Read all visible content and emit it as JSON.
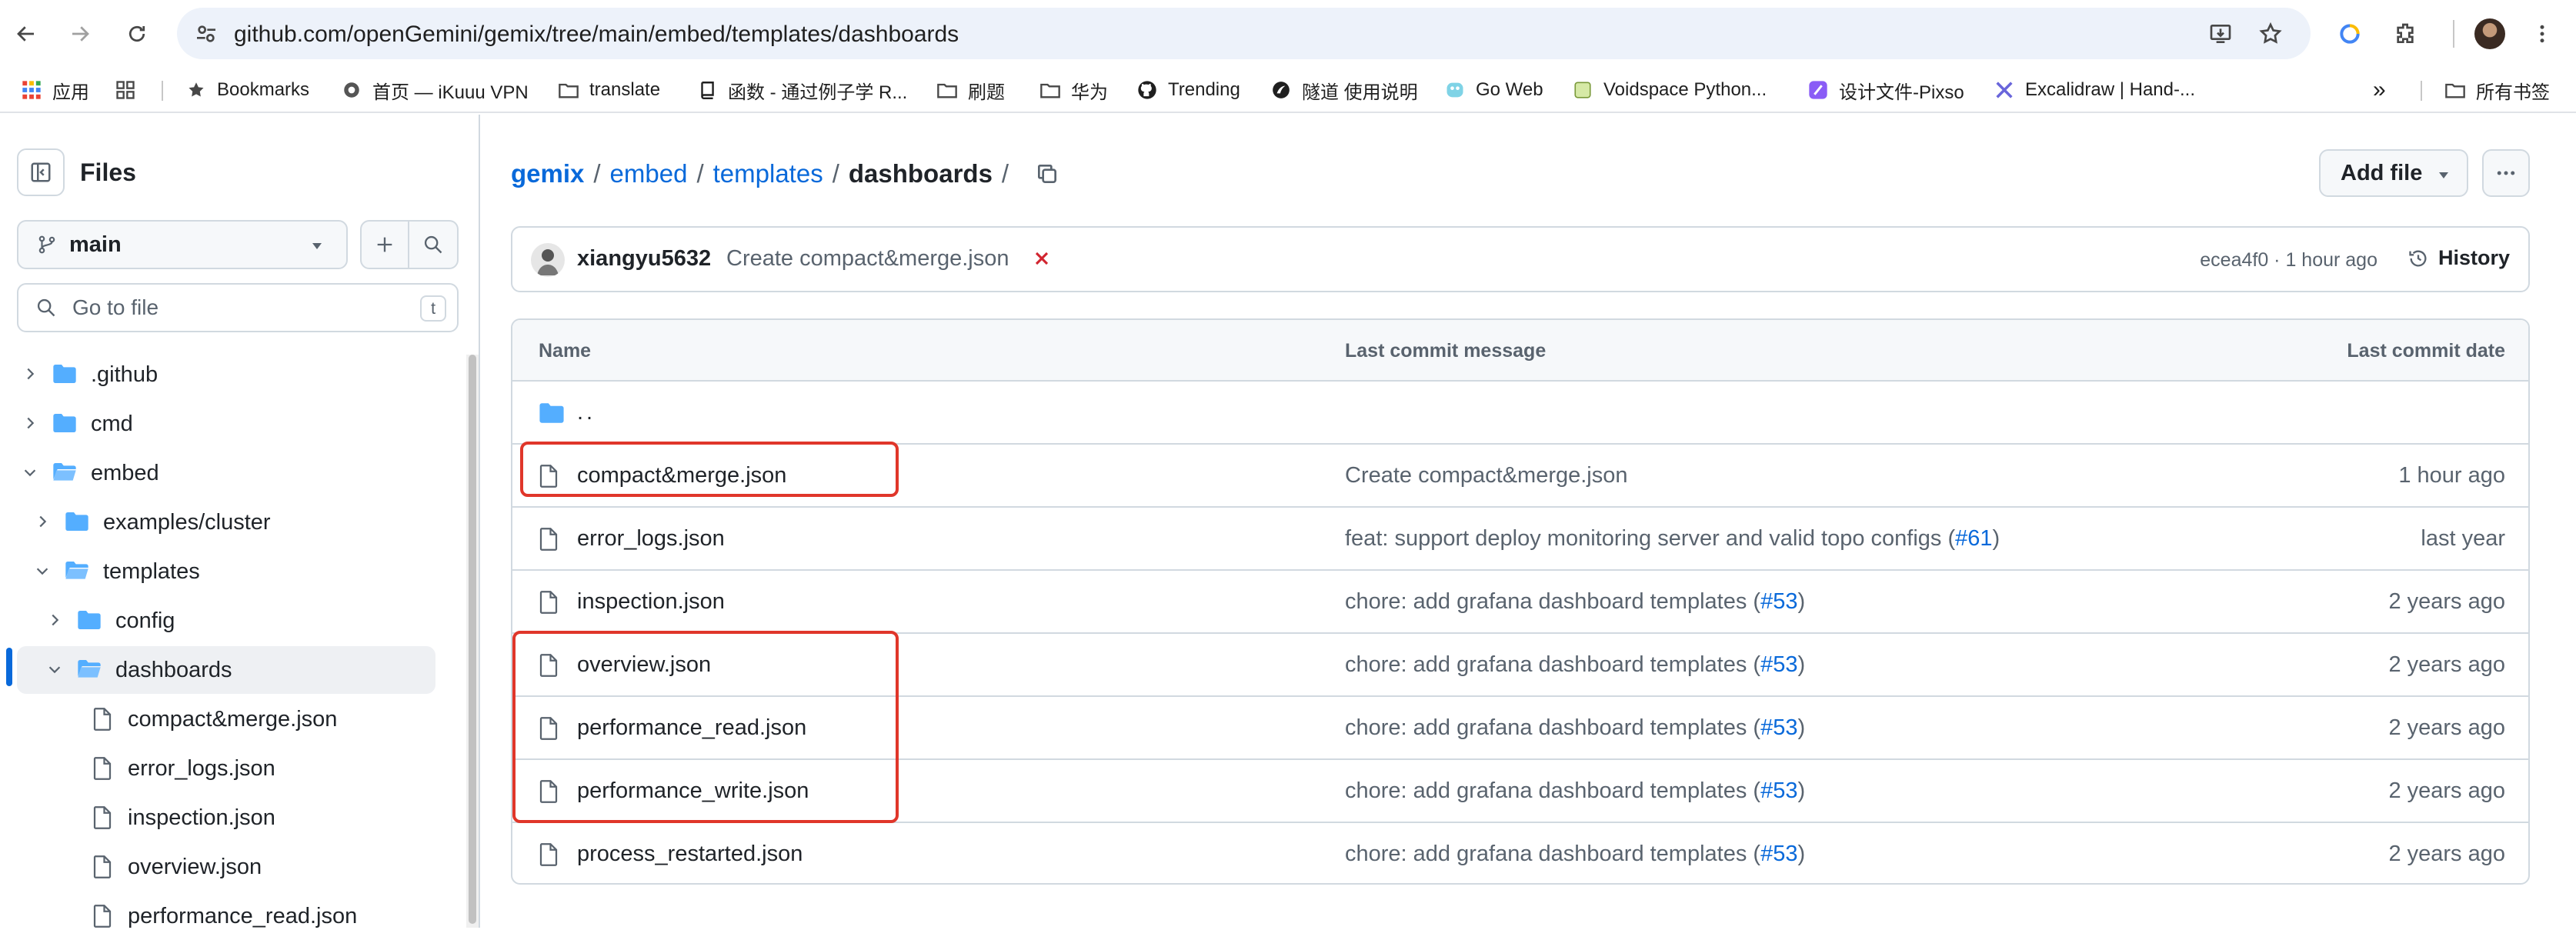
{
  "browser": {
    "url": "github.com/openGemini/gemix/tree/main/embed/templates/dashboards",
    "icons": [
      "back-icon",
      "forward-icon",
      "reload-icon",
      "site-info-icon",
      "install-app-icon",
      "star-icon",
      "extension-icon",
      "profile-avatar",
      "menu-icon"
    ]
  },
  "bookmarks": {
    "items": [
      {
        "label": "应用",
        "icon": "apps-grid-icon"
      },
      {
        "label": "",
        "icon": "tab-groups-icon"
      },
      {
        "label": "Bookmarks",
        "icon": "star-icon"
      },
      {
        "label": "首页 — iKuuu VPN",
        "icon": "site-icon"
      },
      {
        "label": "translate",
        "icon": "folder-icon"
      },
      {
        "label": "函数 - 通过例子学 R...",
        "icon": "book-icon"
      },
      {
        "label": "刷题",
        "icon": "folder-icon"
      },
      {
        "label": "华为",
        "icon": "folder-icon"
      },
      {
        "label": "Trending",
        "icon": "github-icon"
      },
      {
        "label": "隧道 使用说明",
        "icon": "site-icon"
      },
      {
        "label": "Go Web",
        "icon": "gopher-icon"
      },
      {
        "label": "Voidspace Python...",
        "icon": "site-icon"
      },
      {
        "label": "设计文件-Pixso",
        "icon": "pixso-icon"
      },
      {
        "label": "Excalidraw | Hand-...",
        "icon": "excalidraw-icon"
      }
    ],
    "overflow": "»",
    "all_bookmarks": "所有书签"
  },
  "sidebar": {
    "title": "Files",
    "branch": "main",
    "go_to_file_placeholder": "Go to file",
    "go_to_file_key": "t",
    "tree": [
      {
        "label": ".github",
        "type": "folder",
        "depth": 0,
        "expanded": false
      },
      {
        "label": "cmd",
        "type": "folder",
        "depth": 0,
        "expanded": false
      },
      {
        "label": "embed",
        "type": "folder",
        "depth": 0,
        "expanded": true
      },
      {
        "label": "examples/cluster",
        "type": "folder",
        "depth": 1,
        "expanded": false
      },
      {
        "label": "templates",
        "type": "folder",
        "depth": 1,
        "expanded": true
      },
      {
        "label": "config",
        "type": "folder",
        "depth": 2,
        "expanded": false
      },
      {
        "label": "dashboards",
        "type": "folder",
        "depth": 2,
        "expanded": true,
        "selected": true
      },
      {
        "label": "compact&merge.json",
        "type": "file",
        "depth": 3
      },
      {
        "label": "error_logs.json",
        "type": "file",
        "depth": 3
      },
      {
        "label": "inspection.json",
        "type": "file",
        "depth": 3
      },
      {
        "label": "overview.json",
        "type": "file",
        "depth": 3
      },
      {
        "label": "performance_read.json",
        "type": "file",
        "depth": 3
      }
    ]
  },
  "main": {
    "breadcrumb": {
      "repo": "gemix",
      "path": [
        "embed",
        "templates"
      ],
      "current": "dashboards",
      "sep": "/"
    },
    "add_file_label": "Add file",
    "latest_commit": {
      "author": "xiangyu5632",
      "message": "Create compact&merge.json",
      "status": "failed",
      "hash_time": "ecea4f0 · 1 hour ago",
      "history_label": "History"
    },
    "table": {
      "headers": {
        "name": "Name",
        "message": "Last commit message",
        "date": "Last commit date"
      },
      "parent": "..",
      "rows": [
        {
          "name": "compact&merge.json",
          "msg_text": "Create compact&merge.json",
          "msg_link": "",
          "msg_end": "",
          "date": "1 hour ago"
        },
        {
          "name": "error_logs.json",
          "msg_text": "feat: support deploy monitoring server and valid topo configs (",
          "msg_link": "#61",
          "msg_end": ")",
          "date": "last year"
        },
        {
          "name": "inspection.json",
          "msg_text": "chore: add grafana dashboard templates (",
          "msg_link": "#53",
          "msg_end": ")",
          "date": "2 years ago"
        },
        {
          "name": "overview.json",
          "msg_text": "chore: add grafana dashboard templates (",
          "msg_link": "#53",
          "msg_end": ")",
          "date": "2 years ago"
        },
        {
          "name": "performance_read.json",
          "msg_text": "chore: add grafana dashboard templates (",
          "msg_link": "#53",
          "msg_end": ")",
          "date": "2 years ago"
        },
        {
          "name": "performance_write.json",
          "msg_text": "chore: add grafana dashboard templates (",
          "msg_link": "#53",
          "msg_end": ")",
          "date": "2 years ago"
        },
        {
          "name": "process_restarted.json",
          "msg_text": "chore: add grafana dashboard templates (",
          "msg_link": "#53",
          "msg_end": ")",
          "date": "2 years ago"
        }
      ]
    }
  },
  "colors": {
    "link": "#0969da",
    "highlight": "#e0362a",
    "folder": "#54aeff",
    "error": "#d1242f"
  }
}
